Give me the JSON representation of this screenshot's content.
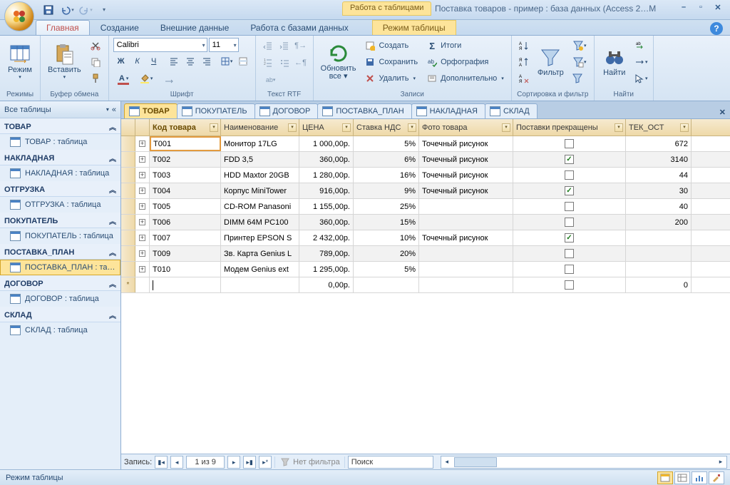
{
  "title": "Поставка товаров - пример : база данных (Access 2…М",
  "context_tab": "Работа с таблицами",
  "tabs": [
    "Главная",
    "Создание",
    "Внешние данные",
    "Работа с базами данных",
    "Режим таблицы"
  ],
  "active_tab": 0,
  "ribbon": {
    "regimy": {
      "label": "Режимы",
      "btn": "Режим"
    },
    "clipboard": {
      "label": "Буфер обмена",
      "paste": "Вставить"
    },
    "font": {
      "label": "Шрифт",
      "family": "Calibri",
      "size": "11"
    },
    "rtf": {
      "label": "Текст RTF"
    },
    "records": {
      "label": "Записи",
      "refresh": "Обновить\nвсе",
      "create": "Создать",
      "save": "Сохранить",
      "delete": "Удалить",
      "totals": "Итоги",
      "spell": "Орфография",
      "more": "Дополнительно"
    },
    "sort": {
      "label": "Сортировка и фильтр",
      "filter": "Фильтр"
    },
    "find": {
      "label": "Найти",
      "find_btn": "Найти"
    }
  },
  "navpane": {
    "header": "Все таблицы",
    "groups": [
      {
        "name": "ТОВАР",
        "items": [
          "ТОВАР : таблица"
        ]
      },
      {
        "name": "НАКЛАДНАЯ",
        "items": [
          "НАКЛАДНАЯ : таблица"
        ]
      },
      {
        "name": "ОТГРУЗКА",
        "items": [
          "ОТГРУЗКА : таблица"
        ]
      },
      {
        "name": "ПОКУПАТЕЛЬ",
        "items": [
          "ПОКУПАТЕЛЬ : таблица"
        ]
      },
      {
        "name": "ПОСТАВКА_ПЛАН",
        "items": [
          "ПОСТАВКА_ПЛАН : та…"
        ],
        "sel": true
      },
      {
        "name": "ДОГОВОР",
        "items": [
          "ДОГОВОР : таблица"
        ]
      },
      {
        "name": "СКЛАД",
        "items": [
          "СКЛАД : таблица"
        ]
      }
    ]
  },
  "doc_tabs": [
    "ТОВАР",
    "ПОКУПАТЕЛЬ",
    "ДОГОВОР",
    "ПОСТАВКА_ПЛАН",
    "НАКЛАДНАЯ",
    "СКЛАД"
  ],
  "doc_active": 0,
  "columns": [
    "Код товара",
    "Наименование",
    "ЦЕНА",
    "Ставка НДС",
    "Фото товара",
    "Поставки прекращены",
    "ТЕК_ОСТ"
  ],
  "rows": [
    {
      "code": "Т001",
      "name": "Монитор 17LG",
      "price": "1 000,00р.",
      "vat": "5%",
      "photo": "Точечный рисунок",
      "stopped": false,
      "stock": "672"
    },
    {
      "code": "Т002",
      "name": "FDD 3,5",
      "price": "360,00р.",
      "vat": "6%",
      "photo": "Точечный рисунок",
      "stopped": true,
      "stock": "3140"
    },
    {
      "code": "Т003",
      "name": "HDD Maxtor 20GB",
      "price": "1 280,00р.",
      "vat": "16%",
      "photo": "Точечный рисунок",
      "stopped": false,
      "stock": "44"
    },
    {
      "code": "Т004",
      "name": "Корпус MiniTower",
      "price": "916,00р.",
      "vat": "9%",
      "photo": "Точечный рисунок",
      "stopped": true,
      "stock": "30"
    },
    {
      "code": "Т005",
      "name": "CD-ROM Panasoni",
      "price": "1 155,00р.",
      "vat": "25%",
      "photo": "",
      "stopped": false,
      "stock": "40"
    },
    {
      "code": "Т006",
      "name": "DIMM 64M PC100",
      "price": "360,00р.",
      "vat": "15%",
      "photo": "",
      "stopped": false,
      "stock": "200"
    },
    {
      "code": "Т007",
      "name": "Принтер EPSON S",
      "price": "2 432,00р.",
      "vat": "10%",
      "photo": "Точечный рисунок",
      "stopped": true,
      "stock": ""
    },
    {
      "code": "Т009",
      "name": "Зв. Карта Genius L",
      "price": "789,00р.",
      "vat": "20%",
      "photo": "",
      "stopped": false,
      "stock": ""
    },
    {
      "code": "Т010",
      "name": "Модем Genius ext",
      "price": "1 295,00р.",
      "vat": "5%",
      "photo": "",
      "stopped": false,
      "stock": ""
    }
  ],
  "new_row": {
    "price": "0,00р.",
    "stock": "0"
  },
  "recnav": {
    "label": "Запись:",
    "pos": "1 из 9",
    "nofilter": "Нет фильтра",
    "search": "Поиск"
  },
  "status": "Режим таблицы"
}
